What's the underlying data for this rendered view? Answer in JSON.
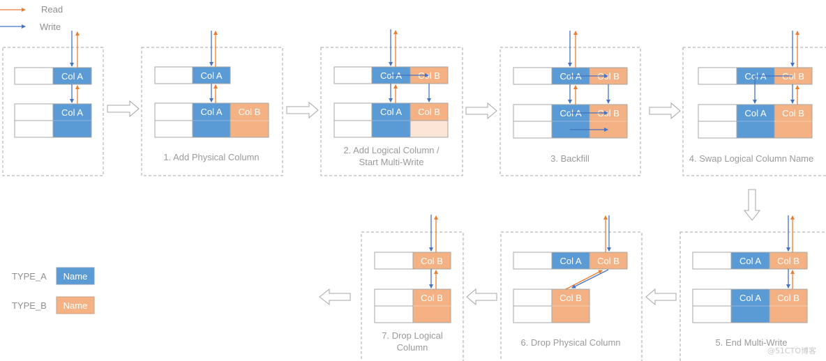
{
  "colors": {
    "type_a": "#5b9bd5",
    "type_b": "#f4b183",
    "type_b_light": "#fbe5d6",
    "read_arrow": "#ed7d31",
    "write_arrow": "#4472c4",
    "border": "#a6a6a6",
    "dashed": "#a6a6a6",
    "caption": "#9a9a9a"
  },
  "arrow_legend": {
    "read_label": "Read",
    "write_label": "Write"
  },
  "type_legend": {
    "type_a_label": "TYPE_A",
    "type_a_swatch": "Name",
    "type_b_label": "TYPE_B",
    "type_b_swatch": "Name"
  },
  "steps": [
    {
      "id": "step-0",
      "caption": "",
      "logical": [
        "Col A"
      ],
      "physical": [
        "Col A"
      ]
    },
    {
      "id": "step-1",
      "caption": "1. Add Physical Column",
      "logical": [
        "Col A"
      ],
      "physical": [
        "Col A",
        "Col B"
      ]
    },
    {
      "id": "step-2",
      "caption_lines": [
        "2. Add Logical Column /",
        "Start Multi-Write"
      ],
      "logical": [
        "Col A",
        "Col B"
      ],
      "physical": [
        "Col A",
        "Col B"
      ]
    },
    {
      "id": "step-3",
      "caption": "3. Backfill",
      "logical": [
        "Col A",
        "Col B"
      ],
      "physical": [
        "Col A",
        "Col B"
      ]
    },
    {
      "id": "step-4",
      "caption": "4. Swap Logical Column Name",
      "logical": [
        "Col A",
        "Col B"
      ],
      "physical": [
        "Col A",
        "Col B"
      ]
    },
    {
      "id": "step-5",
      "caption": "5. End Multi-Write",
      "logical": [
        "Col A",
        "Col B"
      ],
      "physical": [
        "Col A",
        "Col B"
      ]
    },
    {
      "id": "step-6",
      "caption": "6. Drop Physical Column",
      "logical": [
        "Col A",
        "Col B"
      ],
      "physical": [
        "Col B"
      ]
    },
    {
      "id": "step-7",
      "caption_lines": [
        "7. Drop Logical",
        "Column"
      ],
      "logical": [
        "Col B"
      ],
      "physical": [
        "Col B"
      ]
    }
  ],
  "labels": {
    "col_a": "Col A",
    "col_b": "Col B"
  },
  "watermark": "@51CTO博客"
}
